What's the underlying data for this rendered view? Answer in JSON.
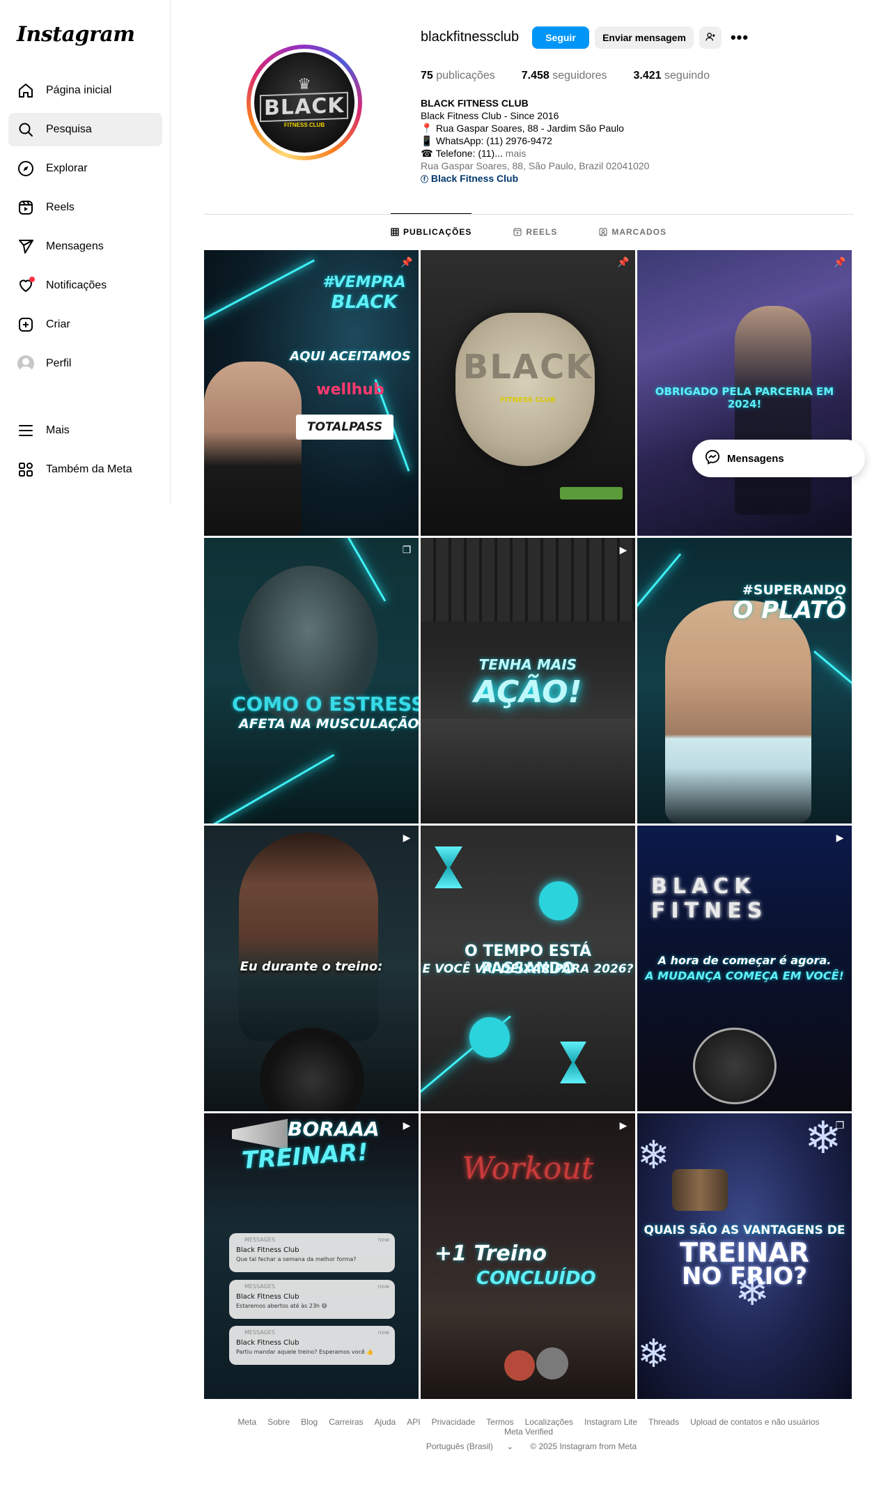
{
  "sidebar": {
    "logo": "Instagram",
    "items": [
      {
        "label": "Página inicial",
        "icon": "home-icon"
      },
      {
        "label": "Pesquisa",
        "icon": "search-icon"
      },
      {
        "label": "Explorar",
        "icon": "compass-icon"
      },
      {
        "label": "Reels",
        "icon": "reels-icon"
      },
      {
        "label": "Mensagens",
        "icon": "paper-plane-icon"
      },
      {
        "label": "Notificações",
        "icon": "heart-icon"
      },
      {
        "label": "Criar",
        "icon": "plus-square-icon"
      },
      {
        "label": "Perfil",
        "icon": "avatar-icon"
      }
    ],
    "bottom_items": [
      {
        "label": "Mais",
        "icon": "menu-icon"
      },
      {
        "label": "Também da Meta",
        "icon": "meta-apps-icon"
      }
    ]
  },
  "profile": {
    "username": "blackfitnessclub",
    "follow_label": "Seguir",
    "message_label": "Enviar mensagem",
    "stats": {
      "posts_count": "75",
      "posts_label": "publicações",
      "followers_count": "7.458",
      "followers_label": "seguidores",
      "following_count": "3.421",
      "following_label": "seguindo"
    },
    "bio": {
      "name": "BLACK FITNESS CLUB",
      "line1": "Black Fitness Club - Since 2016",
      "line2": "Rua Gaspar Soares, 88 - Jardim São Paulo",
      "line3": "WhatsApp: (11) 2976-9472",
      "line4": "Telefone: (11)...",
      "more": "mais",
      "address": "Rua Gaspar Soares, 88, São Paulo, Brazil 02041020",
      "link": "Black Fitness Club"
    },
    "avatar_text": {
      "main": "BLACK",
      "sub": "FITNESS CLUB"
    }
  },
  "tabs": [
    {
      "label": "PUBLICAÇÕES",
      "icon": "grid-icon"
    },
    {
      "label": "REELS",
      "icon": "reels-icon"
    },
    {
      "label": "MARCADOS",
      "icon": "tagged-icon"
    }
  ],
  "posts": [
    {
      "type": "pinned",
      "lines": [
        "#VEMPRA",
        "BLACK",
        "AQUI ACEITAMOS",
        "wellhub",
        "TOTALPASS"
      ]
    },
    {
      "type": "pinned",
      "lines": [
        "BLACK",
        "FITNESS CLUB"
      ]
    },
    {
      "type": "pinned",
      "lines": [
        "OBRIGADO PELA PARCERIA EM 2024!"
      ]
    },
    {
      "type": "carousel",
      "lines": [
        "COMO O ESTRESS",
        "AFETA NA MUSCULAÇÃO!"
      ]
    },
    {
      "type": "reel",
      "lines": [
        "TENHA MAIS",
        "AÇÃO!"
      ]
    },
    {
      "type": "none",
      "lines": [
        "#SUPERANDO",
        "O PLATÔ"
      ]
    },
    {
      "type": "reel",
      "lines": [
        "Eu durante o treino:"
      ]
    },
    {
      "type": "none",
      "lines": [
        "O TEMPO ESTÁ PASSANDO",
        "E VOCÊ VAI DEIXAR PARA 2026?"
      ]
    },
    {
      "type": "reel",
      "lines": [
        "BLACK FITNES",
        "A hora de começar é agora.",
        "A MUDANÇA COMEÇA EM VOCÊ!"
      ]
    },
    {
      "type": "reel",
      "lines": [
        "BORAAA",
        "TREINAR!"
      ],
      "notifications": [
        {
          "app": "MESSAGES",
          "time": "now",
          "title": "Black Fitness Club",
          "body": "Que tal fechar a semana da melhor forma?"
        },
        {
          "app": "MESSAGES",
          "time": "now",
          "title": "Black Fitness Club",
          "body": "Estaremos abertos até às 23h 😄"
        },
        {
          "app": "MESSAGES",
          "time": "now",
          "title": "Black Fitness Club",
          "body": "Partiu mandar aquele treino? Esperamos você 👍"
        }
      ]
    },
    {
      "type": "reel",
      "lines": [
        "Workout",
        "+1 Treino",
        "CONCLUÍDO"
      ]
    },
    {
      "type": "carousel",
      "lines": [
        "QUAIS SÃO AS VANTAGENS DE",
        "TREINAR",
        "NO FRIO?"
      ]
    }
  ],
  "messages_pill": {
    "label": "Mensagens"
  },
  "footer": {
    "links": [
      "Meta",
      "Sobre",
      "Blog",
      "Carreiras",
      "Ajuda",
      "API",
      "Privacidade",
      "Termos",
      "Localizações",
      "Instagram Lite",
      "Threads",
      "Upload de contatos e não usuários",
      "Meta Verified"
    ],
    "language": "Português (Brasil)",
    "copyright": "© 2025 Instagram from Meta"
  },
  "colors": {
    "accent": "#0095f6",
    "neon": "#3ef1f5",
    "notification": "#ff3040"
  }
}
